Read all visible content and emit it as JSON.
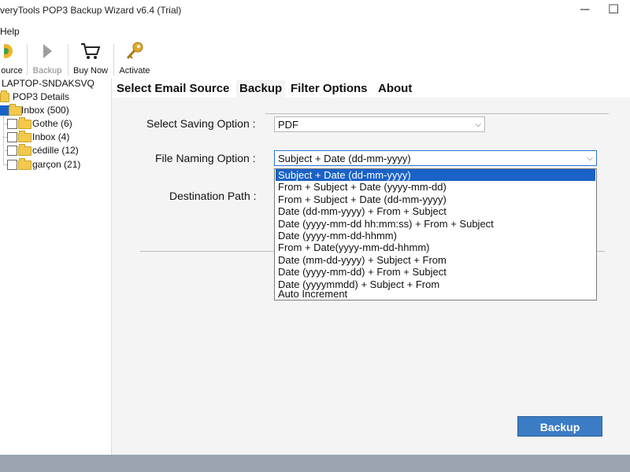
{
  "window": {
    "title": "veryTools POP3 Backup Wizard v6.4 (Trial)",
    "minimize": "─",
    "maximize": "☐"
  },
  "menu": {
    "help": "Help"
  },
  "toolbar": {
    "source": "ource",
    "backup": "Backup",
    "buy_now": "Buy Now",
    "activate": "Activate"
  },
  "tree": {
    "root": "LAPTOP-SNDAKSVQ",
    "account": "POP3 Details",
    "inbox": "Inbox (500)",
    "folders": [
      "Gothe (6)",
      "Inbox (4)",
      "cédille (12)",
      "garçon (21)"
    ]
  },
  "tabs": [
    "Select Email Source",
    "Backup",
    "Filter Options",
    "About"
  ],
  "form": {
    "saving_label": "Select Saving Option :",
    "saving_value": "PDF",
    "naming_label": "File Naming Option :",
    "naming_value": "Subject + Date (dd-mm-yyyy)",
    "destination_label": "Destination Path :",
    "naming_options": [
      "Subject + Date (dd-mm-yyyy)",
      "From + Subject + Date (yyyy-mm-dd)",
      "From + Subject + Date (dd-mm-yyyy)",
      "Date (dd-mm-yyyy) + From + Subject",
      "Date (yyyy-mm-dd hh:mm:ss) + From + Subject",
      "Date (yyyy-mm-dd-hhmm)",
      "From + Date(yyyy-mm-dd-hhmm)",
      "Date (mm-dd-yyyy) + Subject + From",
      "Date (yyyy-mm-dd) + From + Subject",
      "Date (yyyymmdd) + Subject + From",
      "Auto Increment"
    ]
  },
  "actions": {
    "backup": "Backup"
  },
  "colors": {
    "accent": "#1a62c7",
    "button": "#3b7cc4",
    "folder": "#f2c94c"
  }
}
